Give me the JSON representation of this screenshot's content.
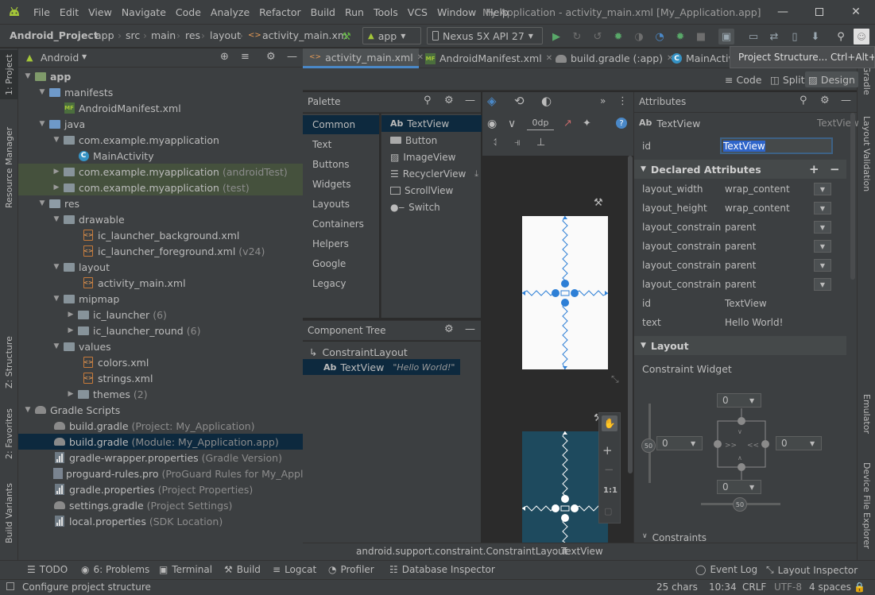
{
  "title_bar": {
    "menus": [
      "File",
      "Edit",
      "View",
      "Navigate",
      "Code",
      "Analyze",
      "Refactor",
      "Build",
      "Run",
      "Tools",
      "VCS",
      "Window",
      "Help"
    ],
    "window_title": "My Application - activity_main.xml [My_Application.app]"
  },
  "breadcrumbs": [
    "Android_Project",
    "app",
    "src",
    "main",
    "res",
    "layout",
    "activity_main.xm"
  ],
  "run_config": "app",
  "device": "Nexus 5X API 27",
  "tooltip": "Project Structure...  Ctrl+Alt+Shift+S",
  "left_strip": {
    "project": "1: Project",
    "resource_manager": "Resource Manager",
    "structure": "Z: Structure",
    "favorites": "2: Favorites",
    "build_variants": "Build Variants"
  },
  "right_strip": {
    "gradle": "Gradle",
    "layout_validation": "Layout Validation",
    "emulator": "Emulator",
    "device_file_explorer": "Device File Explorer"
  },
  "project_panel": {
    "view": "Android",
    "tree": [
      {
        "label": "app",
        "hint": ""
      },
      {
        "label": "manifests",
        "hint": ""
      },
      {
        "label": "AndroidManifest.xml",
        "hint": ""
      },
      {
        "label": "java",
        "hint": ""
      },
      {
        "label": "com.example.myapplication",
        "hint": ""
      },
      {
        "label": "MainActivity",
        "hint": ""
      },
      {
        "label": "com.example.myapplication",
        "hint": "(androidTest)"
      },
      {
        "label": "com.example.myapplication",
        "hint": "(test)"
      },
      {
        "label": "res",
        "hint": ""
      },
      {
        "label": "drawable",
        "hint": ""
      },
      {
        "label": "ic_launcher_background.xml",
        "hint": ""
      },
      {
        "label": "ic_launcher_foreground.xml",
        "hint": "(v24)"
      },
      {
        "label": "layout",
        "hint": ""
      },
      {
        "label": "activity_main.xml",
        "hint": ""
      },
      {
        "label": "mipmap",
        "hint": ""
      },
      {
        "label": "ic_launcher",
        "hint": "(6)"
      },
      {
        "label": "ic_launcher_round",
        "hint": "(6)"
      },
      {
        "label": "values",
        "hint": ""
      },
      {
        "label": "colors.xml",
        "hint": ""
      },
      {
        "label": "strings.xml",
        "hint": ""
      },
      {
        "label": "themes",
        "hint": "(2)"
      },
      {
        "label": "Gradle Scripts",
        "hint": ""
      },
      {
        "label": "build.gradle",
        "hint": "(Project: My_Application)"
      },
      {
        "label": "build.gradle",
        "hint": "(Module: My_Application.app)"
      },
      {
        "label": "gradle-wrapper.properties",
        "hint": "(Gradle Version)"
      },
      {
        "label": "proguard-rules.pro",
        "hint": "(ProGuard Rules for My_Application"
      },
      {
        "label": "gradle.properties",
        "hint": "(Project Properties)"
      },
      {
        "label": "settings.gradle",
        "hint": "(Project Settings)"
      },
      {
        "label": "local.properties",
        "hint": "(SDK Location)"
      }
    ]
  },
  "editor_tabs": [
    "activity_main.xml",
    "AndroidManifest.xml",
    "build.gradle (:app)",
    "MainActiv"
  ],
  "view_modes": {
    "code": "Code",
    "split": "Split",
    "design": "Design"
  },
  "palette": {
    "title": "Palette",
    "categories": [
      "Common",
      "Text",
      "Buttons",
      "Widgets",
      "Layouts",
      "Containers",
      "Helpers",
      "Google",
      "Legacy"
    ],
    "items": [
      "TextView",
      "Button",
      "ImageView",
      "RecyclerView",
      "ScrollView",
      "Switch"
    ]
  },
  "component_tree": {
    "title": "Component Tree",
    "root": "ConstraintLayout",
    "child": "TextView",
    "child_text": "\"Hello World!\""
  },
  "design_toolbar": {
    "margin": "0dp"
  },
  "zoom_controls": {
    "fit": "1:1"
  },
  "attributes": {
    "title": "Attributes",
    "widget": "TextView",
    "widget_right": "TextView",
    "id_label": "id",
    "id_value": "TextView",
    "declared_title": "Declared Attributes",
    "declared": [
      {
        "k": "layout_width",
        "v": "wrap_content"
      },
      {
        "k": "layout_height",
        "v": "wrap_content"
      },
      {
        "k": "layout_constrain...",
        "v": "parent"
      },
      {
        "k": "layout_constrain...",
        "v": "parent"
      },
      {
        "k": "layout_constrain...",
        "v": "parent"
      },
      {
        "k": "layout_constrain...",
        "v": "parent"
      },
      {
        "k": "id",
        "v": "TextView"
      },
      {
        "k": "text",
        "v": "Hello World!"
      }
    ],
    "layout_title": "Layout",
    "constraint_widget": "Constraint Widget",
    "margins": {
      "top": "0",
      "left": "0",
      "right": "0",
      "bottom": "0"
    },
    "bias": {
      "vertical": "50",
      "horizontal": "50"
    },
    "constraints_title": "Constraints"
  },
  "breadcrumb_bottom": [
    "android.support.constraint.ConstraintLayout",
    "TextView"
  ],
  "tool_windows": [
    "TODO",
    "6: Problems",
    "Terminal",
    "Build",
    "Logcat",
    "Profiler",
    "Database Inspector"
  ],
  "tool_windows_right": [
    "Event Log",
    "Layout Inspector"
  ],
  "status": {
    "message": "Configure project structure",
    "chars": "25 chars",
    "position": "10:34",
    "line_sep": "CRLF",
    "encoding": "UTF-8",
    "indent": "4 spaces"
  },
  "colors": {
    "accent": "#4a88c7",
    "selection": "#0d293e",
    "blueprint": "#1e4a5e",
    "constraint": "#2d7fd6"
  }
}
